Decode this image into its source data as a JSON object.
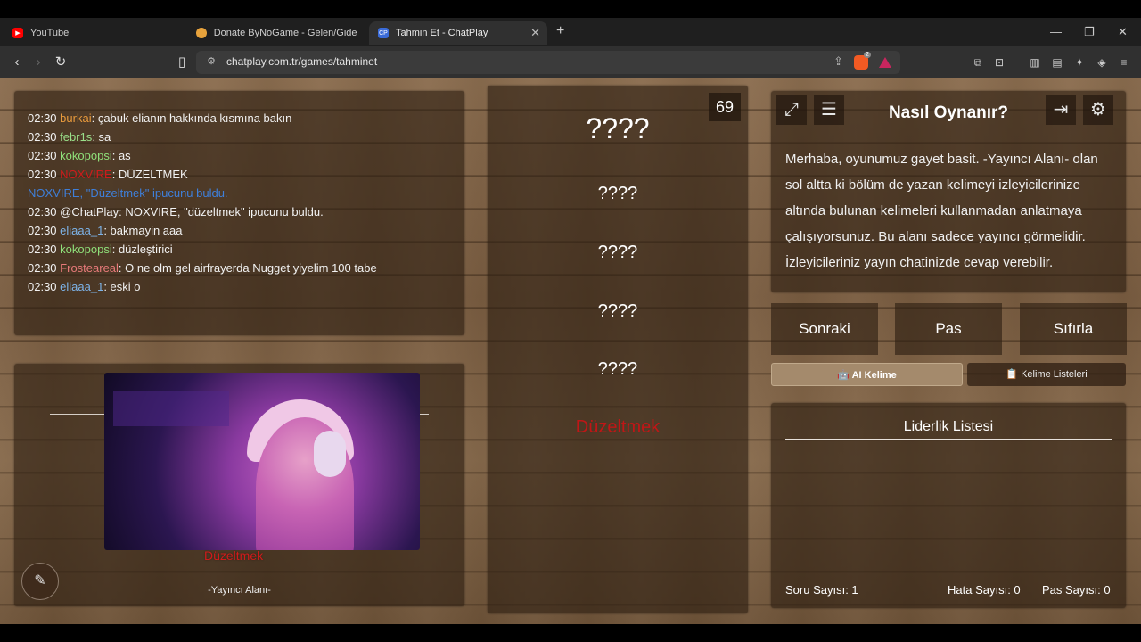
{
  "browser": {
    "tabs": [
      {
        "label": "YouTube",
        "favicon": "youtube-icon",
        "color": "#ff0000"
      },
      {
        "label": "Donate ByNoGame - Gelen/Giden Ba",
        "favicon": "bynogame-icon",
        "color": "#e8a33c"
      },
      {
        "label": "Tahmin Et - ChatPlay",
        "favicon": "chatplay-icon",
        "color": "#3a6bd8",
        "favicon_text": "CP"
      }
    ],
    "url": "chatplay.com.tr/games/tahminet",
    "brave_badge": "2"
  },
  "chat": {
    "messages": [
      {
        "time": "02:30",
        "user": "burkai",
        "user_color": "#e89a3c",
        "text": ": çabuk elianın hakkında kısmına bakın"
      },
      {
        "time": "02:30",
        "user": "febr1s",
        "user_color": "#9ae08a",
        "text": ": sa"
      },
      {
        "time": "02:30",
        "user": "kokopopsi",
        "user_color": "#8fe07a",
        "text": ": as"
      },
      {
        "time": "02:30",
        "user": "NOXVIRE",
        "user_color": "#d01b1b",
        "text": ": DÜZELTMEK"
      },
      {
        "time": "",
        "user": "NOXVIRE",
        "user_color": "#3f7fd9",
        "text": ", \"Düzeltmek\" ipucunu buldu.",
        "system": true
      },
      {
        "time": "02:30",
        "user": "@ChatPlay",
        "user_color": "#f2f2f2",
        "text": ": NOXVIRE, \"düzeltmek\" ipucunu buldu."
      },
      {
        "time": "02:30",
        "user": "eliaaa_1",
        "user_color": "#7db3e8",
        "text": ": bakmayin aaa"
      },
      {
        "time": "02:30",
        "user": "kokopopsi",
        "user_color": "#8fe07a",
        "text": ": düzleştirici"
      },
      {
        "time": "02:30",
        "user": "Frosteareal",
        "user_color": "#e87a7a",
        "text": ": O ne olm gel airfrayerda Nugget yiyelim 100 tabe"
      },
      {
        "time": "02:30",
        "user": "eliaaa_1",
        "user_color": "#7db3e8",
        "text": ": eski o"
      }
    ]
  },
  "streamer": {
    "overlay_word": "Düzeltmek",
    "label": "-Yayıncı Alanı-"
  },
  "words": {
    "counter": "69",
    "main": "????",
    "hidden": [
      "????",
      "????",
      "????",
      "????"
    ],
    "found": "Düzeltmek"
  },
  "howto": {
    "title": "Nasıl Oynanır?",
    "text": "Merhaba, oyunumuz gayet basit. -Yayıncı Alanı- olan sol altta ki bölüm de yazan kelimeyi izleyicilerinize altında bulunan kelimeleri kullanmadan anlatmaya çalışıyorsunuz. Bu alanı sadece yayıncı görmelidir. İzleyicileriniz yayın chatinizde cevap verebilir."
  },
  "controls": {
    "next": "Sonraki",
    "pass": "Pas",
    "reset": "Sıfırla",
    "ai_word": "🤖 AI Kelime",
    "word_lists": "📋 Kelime Listeleri"
  },
  "leaderboard": {
    "title": "Liderlik Listesi",
    "question_count": "Soru Sayısı: 1",
    "error_count": "Hata Sayısı: 0",
    "pass_count": "Pas Sayısı: 0"
  }
}
